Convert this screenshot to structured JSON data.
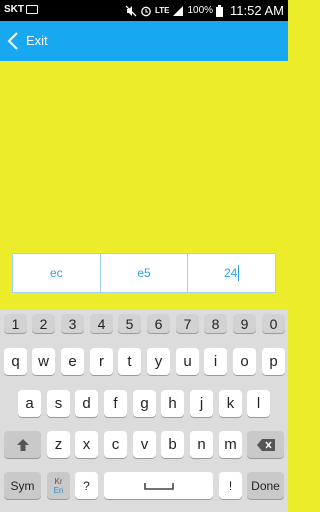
{
  "status_bar": {
    "carrier": "SKT",
    "network": "LTE",
    "battery_percent": "100%",
    "time": "11:52 AM"
  },
  "app_bar": {
    "back_label": "Exit"
  },
  "cells": [
    "ec",
    "e5",
    "24"
  ],
  "keyboard": {
    "number_row": [
      "1",
      "2",
      "3",
      "4",
      "5",
      "6",
      "7",
      "8",
      "9",
      "0"
    ],
    "row1": [
      "q",
      "w",
      "e",
      "r",
      "t",
      "y",
      "u",
      "i",
      "o",
      "p"
    ],
    "row2": [
      "a",
      "s",
      "d",
      "f",
      "g",
      "h",
      "j",
      "k",
      "l"
    ],
    "row3": [
      "z",
      "x",
      "c",
      "v",
      "b",
      "n",
      "m"
    ],
    "sym_label": "Sym",
    "lang_top": "Kr",
    "lang_bottom": "En",
    "question_label": "?",
    "exclaim_label": "!",
    "done_label": "Done"
  }
}
